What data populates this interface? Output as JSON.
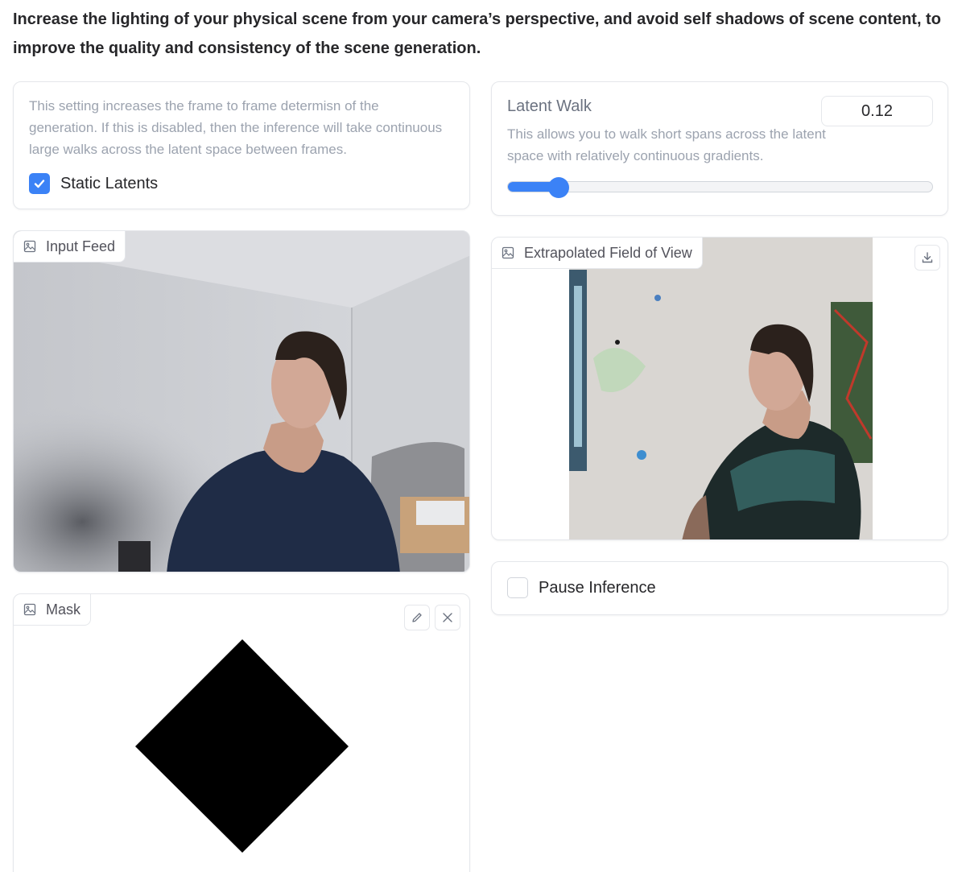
{
  "header": {
    "text": "Increase the lighting of your physical scene from your camera’s perspective, and avoid self shadows of scene content, to improve the quality and consistency of the scene generation."
  },
  "static_latents": {
    "info": "This setting increases the frame to frame determisn of the generation. If this is disabled, then the inference will take continuous large walks across the latent space between frames.",
    "label": "Static Latents",
    "checked": true
  },
  "latent_walk": {
    "label": "Latent Walk",
    "value": "0.12",
    "info": "This allows you to walk short spans across the latent space with relatively continuous gradients.",
    "slider_fraction": 0.12,
    "accent": "#3b82f6"
  },
  "input_feed": {
    "label": "Input Feed",
    "icon": "image-icon"
  },
  "extrapolated": {
    "label": "Extrapolated Field of View",
    "icon": "image-icon",
    "download_icon": "download-icon"
  },
  "pause": {
    "label": "Pause Inference",
    "checked": false
  },
  "mask": {
    "label": "Mask",
    "icon": "image-icon",
    "edit_icon": "pencil-icon",
    "clear_icon": "close-icon"
  }
}
